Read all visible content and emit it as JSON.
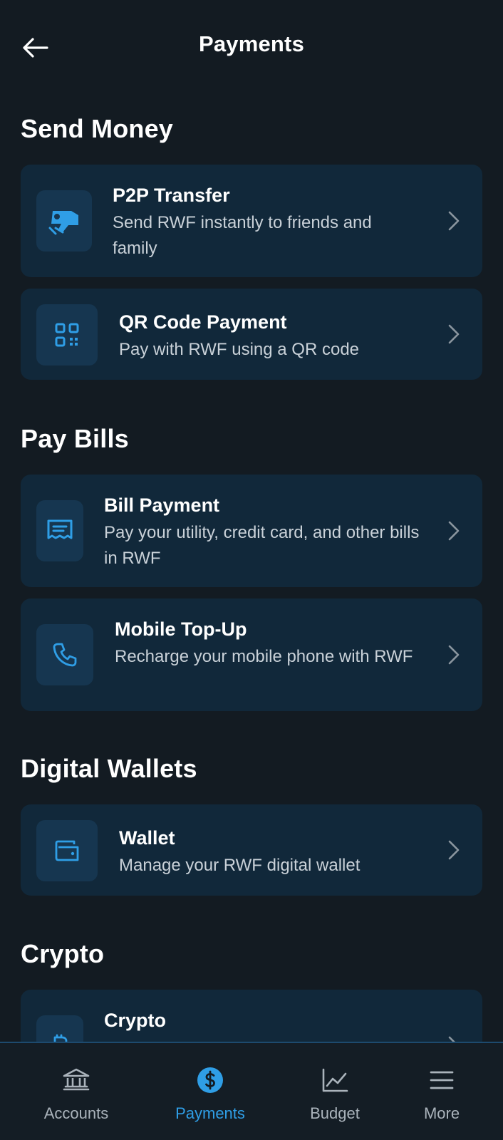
{
  "header": {
    "title": "Payments"
  },
  "sections": [
    {
      "title": "Send Money",
      "items": [
        {
          "title": "P2P Transfer",
          "description": "Send RWF instantly to friends and family",
          "icon": "hand-money-icon"
        },
        {
          "title": "QR Code Payment",
          "description": "Pay with RWF using a QR code",
          "icon": "qr-code-icon"
        }
      ]
    },
    {
      "title": "Pay Bills",
      "items": [
        {
          "title": "Bill Payment",
          "description": "Pay your utility, credit card, and other bills in RWF",
          "icon": "receipt-icon"
        },
        {
          "title": "Mobile Top-Up",
          "description": "Recharge your mobile phone with RWF",
          "icon": "phone-icon"
        }
      ]
    },
    {
      "title": "Digital Wallets",
      "items": [
        {
          "title": "Wallet",
          "description": "Manage your RWF digital wallet",
          "icon": "wallet-icon"
        }
      ]
    },
    {
      "title": "Crypto",
      "items": [
        {
          "title": "Crypto",
          "description": "",
          "icon": "bitcoin-icon"
        }
      ]
    }
  ],
  "bottom_nav": {
    "items": [
      {
        "label": "Accounts",
        "icon": "bank-icon",
        "active": false
      },
      {
        "label": "Payments",
        "icon": "dollar-circle-icon",
        "active": true
      },
      {
        "label": "Budget",
        "icon": "chart-icon",
        "active": false
      },
      {
        "label": "More",
        "icon": "menu-icon",
        "active": false
      }
    ]
  },
  "colors": {
    "background": "#131b22",
    "card": "#11283a",
    "accent": "#2f9ee6",
    "icon_box": "#163650"
  }
}
